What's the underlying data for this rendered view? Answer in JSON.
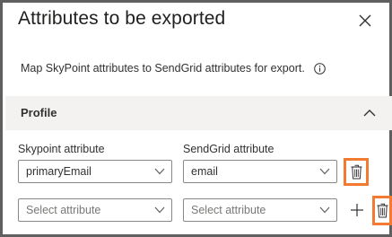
{
  "panel": {
    "title": "Attributes to be exported",
    "description": "Map SkyPoint attributes to SendGrid attributes for export."
  },
  "section": {
    "label": "Profile"
  },
  "columns": {
    "source_label": "Skypoint attribute",
    "target_label": "SendGrid attribute"
  },
  "rows": [
    {
      "source_value": "primaryEmail",
      "target_value": "email"
    },
    {
      "source_placeholder": "Select attribute",
      "target_placeholder": "Select attribute"
    }
  ],
  "colors": {
    "highlight": "#f27a31",
    "border": "#8a8886",
    "section_bg": "#f3f2f1"
  },
  "icons": [
    "close-icon",
    "info-icon",
    "chevron-up-icon",
    "chevron-down-icon",
    "trash-icon",
    "plus-icon"
  ]
}
